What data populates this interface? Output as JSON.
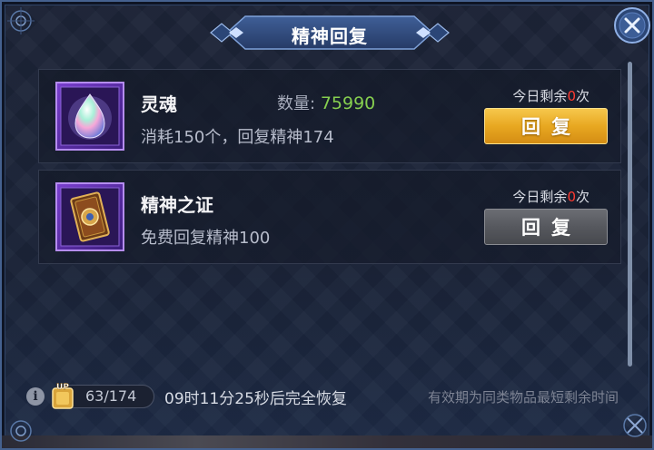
{
  "title": "精神回复",
  "items": [
    {
      "name": "灵魂",
      "quantity_label": "数量:",
      "quantity_value": "75990",
      "description": "消耗150个，回复精神174",
      "limit_prefix": "今日剩余",
      "limit_count": "0",
      "limit_suffix": "次",
      "button_label": "回复",
      "icon": "soul-gem-icon"
    },
    {
      "name": "精神之证",
      "description": "免费回复精神100",
      "limit_prefix": "今日剩余",
      "limit_count": "0",
      "limit_suffix": "次",
      "button_label": "回复",
      "icon": "spirit-card-icon"
    }
  ],
  "footer": {
    "stamina": "63/174",
    "stamina_badge": "UP",
    "recover_time": "09时11分25秒后完全恢复",
    "validity_note": "有效期为同类物品最短剩余时间",
    "info_symbol": "i"
  },
  "colors": {
    "gold_button": "#e8a821",
    "gray_button": "#56585e",
    "quantity_green": "#86cf4f",
    "limit_red": "#ff3b30"
  }
}
